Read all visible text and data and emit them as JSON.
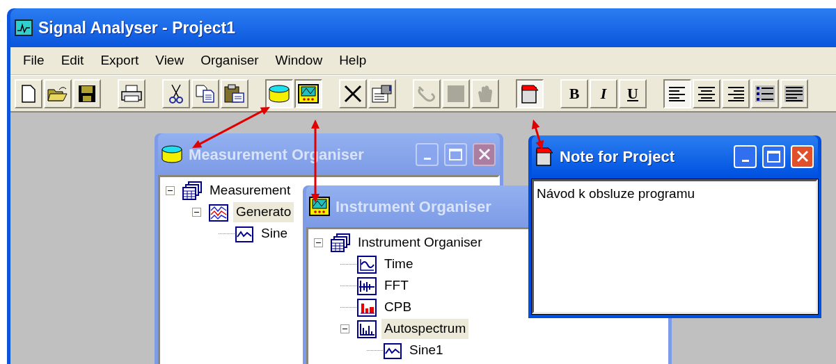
{
  "window": {
    "title": "Signal Analyser - Project1"
  },
  "menu": [
    "File",
    "Edit",
    "Export",
    "View",
    "Organiser",
    "Window",
    "Help"
  ],
  "toolbar": [
    [
      {
        "kind": "new",
        "pressed": false,
        "disabled": false
      },
      {
        "kind": "open",
        "pressed": false,
        "disabled": false
      },
      {
        "kind": "save",
        "pressed": false,
        "disabled": false
      }
    ],
    [
      {
        "kind": "print",
        "pressed": false,
        "disabled": false
      }
    ],
    [
      {
        "kind": "cut",
        "pressed": false,
        "disabled": false
      },
      {
        "kind": "copy",
        "pressed": false,
        "disabled": false
      },
      {
        "kind": "paste",
        "pressed": false,
        "disabled": false
      }
    ],
    [
      {
        "kind": "measurement",
        "pressed": true,
        "disabled": false
      },
      {
        "kind": "instrument",
        "pressed": true,
        "disabled": false
      }
    ],
    [
      {
        "kind": "delete",
        "pressed": false,
        "disabled": false
      },
      {
        "kind": "properties",
        "pressed": false,
        "disabled": false
      }
    ],
    [
      {
        "kind": "link",
        "pressed": false,
        "disabled": true
      },
      {
        "kind": "stop",
        "pressed": false,
        "disabled": true
      },
      {
        "kind": "hand",
        "pressed": false,
        "disabled": true
      }
    ],
    [
      {
        "kind": "note",
        "pressed": true,
        "disabled": false
      }
    ],
    [
      {
        "kind": "bold",
        "label": "B",
        "pressed": false,
        "disabled": false
      },
      {
        "kind": "italic",
        "label": "I",
        "pressed": false,
        "disabled": false
      },
      {
        "kind": "underline",
        "label": "U",
        "pressed": false,
        "disabled": false
      }
    ],
    [
      {
        "kind": "align-left",
        "pressed": true,
        "disabled": false
      },
      {
        "kind": "align-center",
        "pressed": false,
        "disabled": false
      },
      {
        "kind": "align-right",
        "pressed": false,
        "disabled": false
      },
      {
        "kind": "bullets",
        "pressed": false,
        "disabled": false
      },
      {
        "kind": "justify",
        "pressed": false,
        "disabled": false
      }
    ]
  ],
  "child_windows": [
    {
      "kind": "measurement",
      "title": "Measurement Organiser",
      "active": false,
      "tree": [
        {
          "label": "Measurement",
          "kind": "organiser",
          "expanded": true,
          "selected": false,
          "children": [
            {
              "label": "Generato",
              "kind": "generator",
              "expanded": true,
              "selected": true,
              "children": [
                {
                  "label": "Sine",
                  "kind": "signal",
                  "selected": false
                }
              ]
            }
          ]
        }
      ]
    },
    {
      "kind": "instrument",
      "title": "Instrument Organiser",
      "active": false,
      "tree": [
        {
          "label": "Instrument Organiser",
          "kind": "organiser",
          "expanded": true,
          "selected": false,
          "children": [
            {
              "label": "Time",
              "kind": "time",
              "selected": false
            },
            {
              "label": "FFT",
              "kind": "fft",
              "selected": false
            },
            {
              "label": "CPB",
              "kind": "cpb",
              "selected": false
            },
            {
              "label": "Autospectrum",
              "kind": "autospectrum",
              "expanded": true,
              "selected": true,
              "children": [
                {
                  "label": "Sine1",
                  "kind": "signal",
                  "selected": false
                }
              ]
            }
          ]
        }
      ]
    },
    {
      "kind": "note",
      "title": "Note for Project",
      "active": true,
      "text": "Návod k obsluze programu"
    }
  ]
}
